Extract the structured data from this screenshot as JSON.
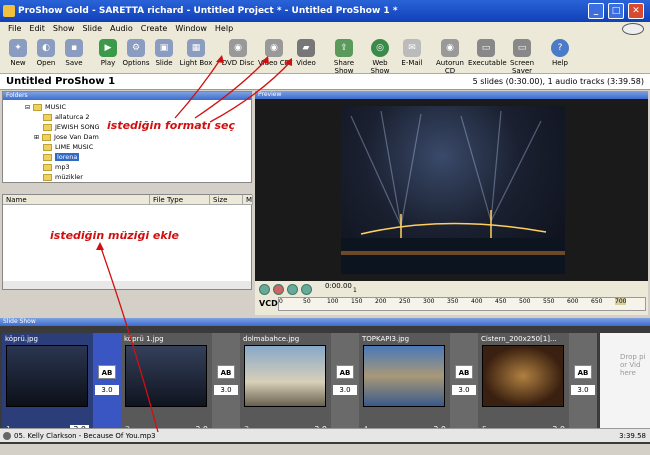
{
  "window": {
    "title": "ProShow Gold - SARETTA richard - Untitled Project * - Untitled ProShow 1 *"
  },
  "menu": [
    "File",
    "Edit",
    "Show",
    "Slide",
    "Audio",
    "Create",
    "Window",
    "Help"
  ],
  "toolbar": [
    {
      "label": "New",
      "icon": "new-icon"
    },
    {
      "label": "Open",
      "icon": "open-icon"
    },
    {
      "label": "Save",
      "icon": "save-icon"
    },
    {
      "label": "Play",
      "icon": "play-icon"
    },
    {
      "label": "Options",
      "icon": "options-icon"
    },
    {
      "label": "Slide",
      "icon": "slide-icon"
    },
    {
      "label": "Light Box",
      "icon": "lightbox-icon"
    },
    {
      "label": "DVD Disc",
      "icon": "dvd-icon"
    },
    {
      "label": "Video CD",
      "icon": "videocd-icon"
    },
    {
      "label": "Video",
      "icon": "video-icon"
    },
    {
      "label": "Share Show",
      "icon": "share-icon"
    },
    {
      "label": "Web Show",
      "icon": "web-icon"
    },
    {
      "label": "E-Mail",
      "icon": "email-icon"
    },
    {
      "label": "Autorun CD",
      "icon": "autorun-icon"
    },
    {
      "label": "Executable",
      "icon": "executable-icon"
    },
    {
      "label": "Screen Saver",
      "icon": "screensaver-icon"
    },
    {
      "label": "Help",
      "icon": "help-icon"
    }
  ],
  "project": {
    "title": "Untitled ProShow 1",
    "info": "5 slides (0:30.00), 1 audio tracks (3:39.58)"
  },
  "folders": {
    "header": "Folders",
    "items": [
      {
        "label": "MUSIC",
        "level": 0,
        "selected": false
      },
      {
        "label": "allaturca 2",
        "level": 1,
        "selected": false
      },
      {
        "label": "JEWISH SONG",
        "level": 1,
        "selected": false
      },
      {
        "label": "Jose Van Dam",
        "level": 1,
        "selected": false
      },
      {
        "label": "LIME MUSIC",
        "level": 1,
        "selected": false
      },
      {
        "label": "lorena",
        "level": 1,
        "selected": true
      },
      {
        "label": "mp3",
        "level": 1,
        "selected": false
      },
      {
        "label": "müzikler",
        "level": 1,
        "selected": false
      }
    ]
  },
  "filelist": {
    "columns": [
      "Name",
      "File Type",
      "Size",
      "M"
    ]
  },
  "preview": {
    "header": "Preview",
    "timecode": "0:00.00",
    "ruler_ticks": [
      "0",
      "50",
      "100",
      "150",
      "200",
      "250",
      "300",
      "350",
      "400",
      "450",
      "500",
      "550",
      "600",
      "650",
      "700"
    ],
    "ruler_label": "VCD",
    "marker": "1"
  },
  "slideshow": {
    "header": "Slide Show",
    "slides": [
      {
        "file": "köprü.jpg",
        "num": "1",
        "dur": "3.0",
        "tdur": "3.0",
        "selected": true
      },
      {
        "file": "köprü 1.jpg",
        "num": "2",
        "dur": "3.0",
        "tdur": "3.0",
        "selected": false
      },
      {
        "file": "dolmabahce.jpg",
        "num": "3",
        "dur": "3.0",
        "tdur": "3.0",
        "selected": false
      },
      {
        "file": "TOPKAPI3.jpg",
        "num": "4",
        "dur": "3.0",
        "tdur": "3.0",
        "selected": false
      },
      {
        "file": "Cistern_200x250[1]...",
        "num": "5",
        "dur": "3.0",
        "tdur": "3.0",
        "selected": false
      }
    ],
    "dropzone": "Drop pi or Vid here"
  },
  "audio": {
    "track": "05. Kelly Clarkson - Because Of You.mp3",
    "length": "3:39.58"
  },
  "annotations": {
    "format": "istediğin formatı seç",
    "music": "istediğin müziği ekle"
  }
}
